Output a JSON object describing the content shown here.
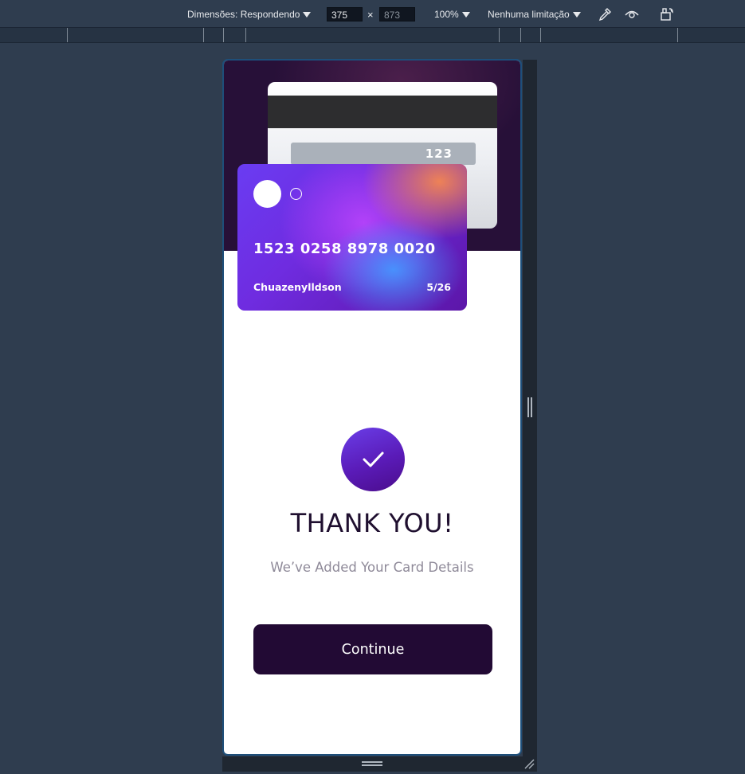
{
  "devtools": {
    "dimensions_label": "Dimensões: Respondendo",
    "width_value": "375",
    "height_value": "873",
    "times_sign": "×",
    "zoom_label": "100%",
    "throttle_label": "Nenhuma limitação",
    "icons": [
      "eyedropper-icon",
      "eye-icon",
      "rotate-device-icon"
    ]
  },
  "card_back": {
    "cvc": "123"
  },
  "card_front": {
    "number": "1523 0258 8978 0020",
    "holder": "Chuazenylldson",
    "expiry": "5/26"
  },
  "confirmation": {
    "title": "THANK YOU!",
    "subtitle": "We’ve Added Your Card Details",
    "button_label": "Continue"
  },
  "colors": {
    "hero_bg": "#271038",
    "button_bg": "#220a34",
    "check_gradient_start": "#6a3ee8",
    "check_gradient_end": "#4b0c8c",
    "title_color": "#1f0f2f",
    "subtitle_color": "#8f8a99",
    "devtools_bg": "#2f3d4f"
  }
}
